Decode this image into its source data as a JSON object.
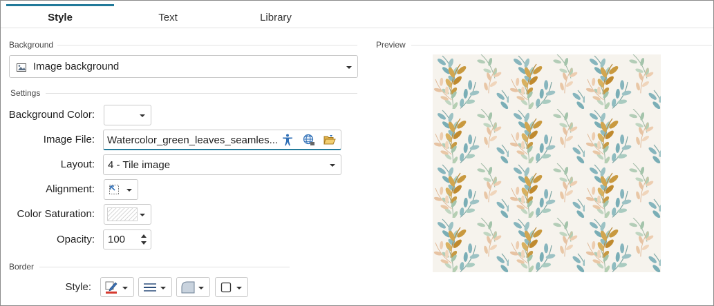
{
  "tabs": [
    {
      "label": "Style",
      "active": true
    },
    {
      "label": "Text",
      "active": false
    },
    {
      "label": "Library",
      "active": false
    }
  ],
  "background_section": {
    "label": "Background",
    "type_dropdown": {
      "icon": "image-icon",
      "value": "Image background"
    }
  },
  "settings_section": {
    "label": "Settings",
    "background_color": {
      "label": "Background Color:",
      "value": "#ffffff"
    },
    "image_file": {
      "label": "Image File:",
      "value": "Watercolor_green_leaves_seamles...",
      "icons": [
        "accessibility-icon",
        "web-globe-icon",
        "open-folder-icon"
      ]
    },
    "layout": {
      "label": "Layout:",
      "value": "4 - Tile image"
    },
    "alignment": {
      "label": "Alignment:",
      "icon": "align-top-left-icon"
    },
    "color_saturation": {
      "label": "Color Saturation:",
      "icon": "saturation-pattern-icon"
    },
    "opacity": {
      "label": "Opacity:",
      "value": "100"
    }
  },
  "border_section": {
    "label": "Border",
    "style_label": "Style:",
    "buttons": [
      "pen-color-icon",
      "line-weight-icon",
      "corner-shape-icon",
      "border-box-icon"
    ]
  },
  "preview_section": {
    "label": "Preview",
    "pattern": "watercolor leaves",
    "colors": {
      "teal": "#7fb3bd",
      "sage": "#9fc0a6",
      "ochre": "#c8983c",
      "peach": "#e8c09e",
      "background": "#f6f3ed"
    }
  },
  "accent_color": "#227a9a"
}
